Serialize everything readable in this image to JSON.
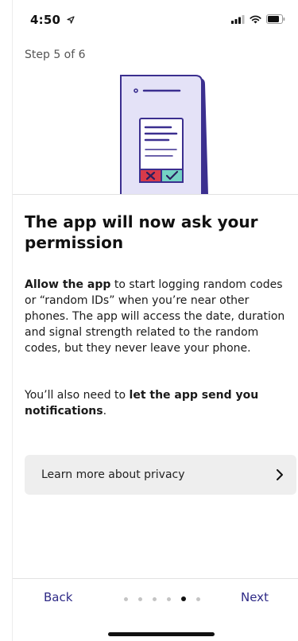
{
  "status_bar": {
    "time": "4:50",
    "icons": [
      "location-arrow-icon",
      "cellular-signal-icon",
      "wifi-icon",
      "battery-icon"
    ]
  },
  "step_label": "Step 5 of 6",
  "illustration": {
    "name": "phone-permission-illustration",
    "colors": {
      "phone_fill": "#e4e2f7",
      "phone_outline": "#3b2f8f",
      "accent": "#5b46c8",
      "deny": "#d83a4a",
      "allow": "#74d3c4"
    }
  },
  "heading": "The app will now ask your permission",
  "paragraph1": {
    "bold": "Allow the app",
    "rest": " to start logging random codes or “random IDs” when you’re near other phones. The app will access the date, duration and signal strength related to the random codes, but they never leave your phone."
  },
  "paragraph2": {
    "prefix": "You’ll also need to ",
    "bold": "let the app send you notifications",
    "suffix": "."
  },
  "privacy_link": {
    "label": "Learn more about privacy",
    "icon": "chevron-right-icon"
  },
  "footer": {
    "back_label": "Back",
    "next_label": "Next",
    "total_steps": 6,
    "current_step": 5
  },
  "colors": {
    "accent_text": "#2e2a86",
    "card_bg": "#eeeeee"
  }
}
